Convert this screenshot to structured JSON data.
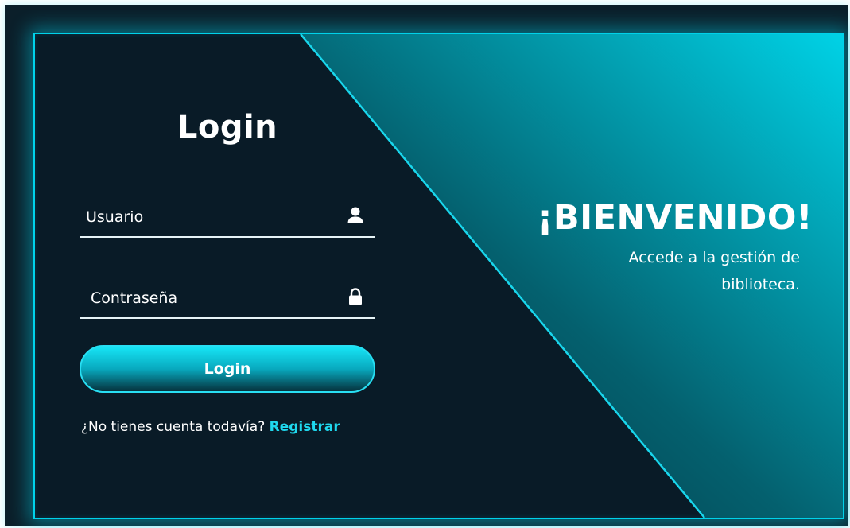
{
  "login": {
    "title": "Login",
    "username_placeholder": "Usuario",
    "password_placeholder": "Contraseña",
    "button_label": "Login",
    "no_account_text": "¿No tienes cuenta todavía?",
    "register_link": "Registrar"
  },
  "welcome": {
    "title": "¡BIENVENIDO!",
    "subtitle": "Accede a la gestión de biblioteca."
  },
  "icons": {
    "username": "user-icon",
    "password": "lock-icon"
  },
  "colors": {
    "background": "#091b27",
    "accent": "#00d2ea",
    "gradient_start": "#022a36",
    "gradient_end": "#00d2e6",
    "text": "#ffffff",
    "link": "#1fd8ee"
  }
}
